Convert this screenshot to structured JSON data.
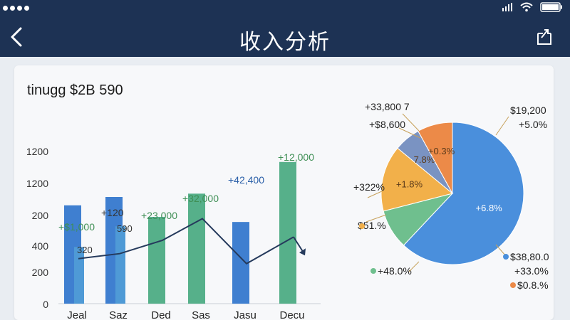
{
  "header": {
    "title": "收入分析"
  },
  "card": {
    "title": "tinugg $2B 590"
  },
  "chart_data": [
    {
      "type": "bar",
      "categories": [
        "Jeal",
        "Saz",
        "Ded",
        "Sas",
        "Jasu",
        "Decu"
      ],
      "y_tick_labels": [
        "0",
        "200",
        "400",
        "200",
        "1200",
        "1200"
      ],
      "series": [
        {
          "color": "#3f7fd0",
          "values": [
            295,
            320,
            260,
            230,
            245,
            140
          ]
        },
        {
          "color": "#4f9ad6",
          "values": [
            170,
            232,
            0,
            0,
            0,
            0
          ]
        },
        {
          "color": "#56b08a",
          "values": [
            0,
            0,
            260,
            330,
            0,
            425
          ]
        }
      ],
      "line_values": [
        135,
        150,
        190,
        255,
        120,
        200
      ],
      "data_labels": [
        "+$1,000",
        "+120",
        "+23,000",
        "+32,000",
        "+42,400",
        "+12,000"
      ],
      "extra_labels": [
        "320",
        "590"
      ]
    },
    {
      "type": "pie",
      "slices": [
        {
          "value": 62,
          "color": "#4a8fdc",
          "label": "+6.8%"
        },
        {
          "value": 9,
          "color": "#6fbf8e",
          "label": ""
        },
        {
          "value": 15,
          "color": "#f2b04a",
          "label": "+1.8%"
        },
        {
          "value": 6,
          "color": "#7a93c2",
          "label": "7.8%"
        },
        {
          "value": 8,
          "color": "#ec8a48",
          "label": "+0.3%"
        }
      ],
      "callouts": [
        "+33,800 7",
        "+$8,600",
        "$19,200",
        "+5.0%",
        "+322%",
        "$51.%",
        "$38,80.0",
        "+33.0%",
        "+48.0%",
        "$0.8.%"
      ]
    }
  ]
}
